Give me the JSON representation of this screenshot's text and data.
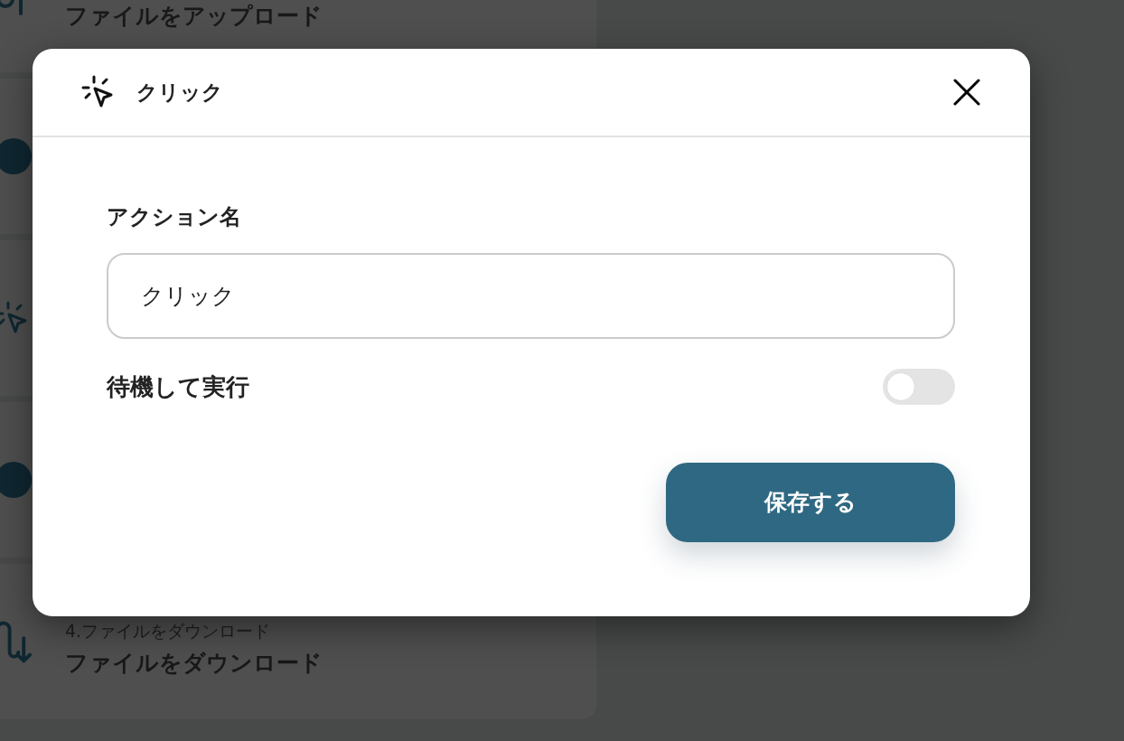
{
  "background_steps": [
    {
      "kind": "upload",
      "title": "ファイルをアップロード"
    },
    {
      "kind": "circle"
    },
    {
      "kind": "click"
    },
    {
      "kind": "circle"
    },
    {
      "kind": "download",
      "subtitle": "4.ファイルをダウンロード",
      "title": "ファイルをダウンロード"
    }
  ],
  "dialog": {
    "title": "クリック",
    "action_name": {
      "label": "アクション名",
      "value": "クリック"
    },
    "wait_toggle": {
      "label": "待機して実行",
      "on": false
    },
    "save_button": "保存する"
  }
}
